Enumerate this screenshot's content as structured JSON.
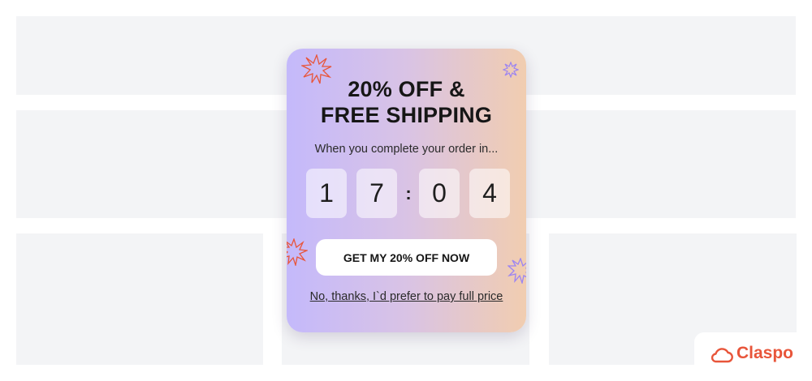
{
  "popup": {
    "headline_line1": "20% OFF &",
    "headline_line2": "FREE SHIPPING",
    "subline": "When you complete your order in...",
    "timer": {
      "digits": [
        "1",
        "7",
        "0",
        "4"
      ],
      "separator": ":"
    },
    "cta_label": "GET MY 20% OFF NOW",
    "decline_label": "No, thanks, I`d prefer to pay full price"
  },
  "branding": {
    "name": "Claspo",
    "icon": "cloud-icon"
  },
  "colors": {
    "gradient_start": "#c4b9fb",
    "gradient_end": "#f1cdb0",
    "accent_orange": "#e8553a",
    "accent_purple": "#9b84f2",
    "placeholder": "#f3f4f6"
  },
  "icons": [
    "burst-star-icon",
    "sparkle-icon"
  ]
}
